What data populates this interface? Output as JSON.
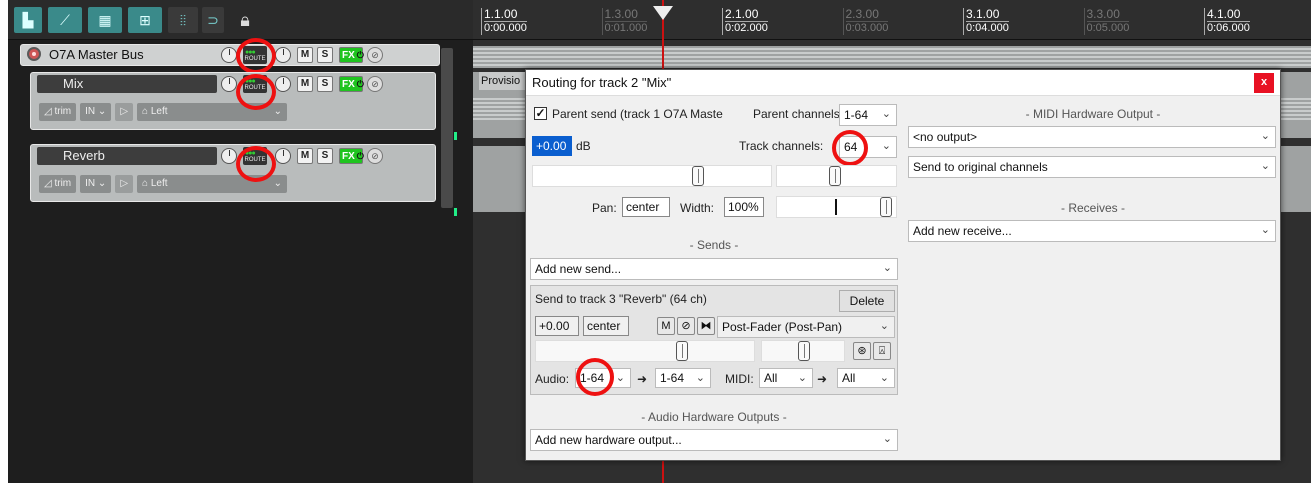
{
  "toolbar": {
    "lock_icon": "lock-icon"
  },
  "tracks": {
    "master": {
      "name": "O7A Master Bus",
      "number": "1",
      "route_label": "ROUTE",
      "mute_label": "M",
      "solo_label": "S",
      "fx_label": "FX"
    },
    "mix": {
      "name": "Mix",
      "number": "2",
      "route_label": "ROUTE",
      "mute_label": "M",
      "solo_label": "S",
      "fx_label": "FX",
      "trim_label": "trim",
      "in_label": "IN",
      "input_label": "Left"
    },
    "reverb": {
      "name": "Reverb",
      "number": "3",
      "route_label": "ROUTE",
      "mute_label": "M",
      "solo_label": "S",
      "fx_label": "FX",
      "trim_label": "trim",
      "in_label": "IN",
      "input_label": "Left"
    }
  },
  "ruler": {
    "marks": [
      {
        "bar": "1.1.00",
        "time": "0:00.000",
        "dim": false
      },
      {
        "bar": "1.3.00",
        "time": "0:01.000",
        "dim": true
      },
      {
        "bar": "2.1.00",
        "time": "0:02.000",
        "dim": false
      },
      {
        "bar": "2.3.00",
        "time": "0:03.000",
        "dim": true
      },
      {
        "bar": "3.1.00",
        "time": "0:04.000",
        "dim": false
      },
      {
        "bar": "3.3.00",
        "time": "0:05.000",
        "dim": true
      },
      {
        "bar": "4.1.00",
        "time": "0:06.000",
        "dim": false
      }
    ]
  },
  "provision_label": "Provisio",
  "dialog": {
    "title": "Routing for track 2 \"Mix\"",
    "close_label": "x",
    "parent_send_label": "Parent send (track 1 O7A Maste",
    "parent_channels_label": "Parent channels:",
    "parent_channels_value": "1-64",
    "volume_value": "+0.00",
    "volume_unit": "dB",
    "track_channels_label": "Track channels:",
    "track_channels_value": "64",
    "pan_label": "Pan:",
    "pan_value": "center",
    "width_label": "Width:",
    "width_value": "100%",
    "sends_header": "- Sends -",
    "add_send": "Add new send...",
    "send": {
      "title": "Send to track 3 \"Reverb\" (64 ch)",
      "delete_label": "Delete",
      "volume_value": "+0.00",
      "pan_value": "center",
      "mute_label": "M",
      "mode_value": "Post-Fader (Post-Pan)",
      "audio_label": "Audio:",
      "audio_src": "1-64",
      "audio_dst": "1-64",
      "midi_label": "MIDI:",
      "midi_src": "All",
      "midi_dst": "All"
    },
    "audio_hw_header": "- Audio Hardware Outputs -",
    "add_hw_output": "Add new hardware output...",
    "midi_hw_header": "- MIDI Hardware Output -",
    "midi_output_value": "<no output>",
    "midi_channel_value": "Send to original channels",
    "receives_header": "- Receives -",
    "add_receive": "Add new receive..."
  }
}
